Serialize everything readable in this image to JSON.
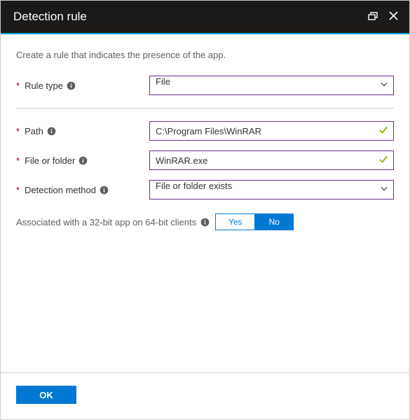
{
  "titlebar": {
    "title": "Detection rule",
    "restore_icon": "restore-icon",
    "close_icon": "close-icon"
  },
  "description": "Create a rule that indicates the presence of the app.",
  "form": {
    "rule_type": {
      "label": "Rule type",
      "value": "File",
      "required": true
    },
    "path": {
      "label": "Path",
      "value": "C:\\Program Files\\WinRAR",
      "required": true,
      "valid": true
    },
    "file_or_folder": {
      "label": "File or folder",
      "value": "WinRAR.exe",
      "required": true,
      "valid": true
    },
    "detection_method": {
      "label": "Detection method",
      "value": "File or folder exists",
      "required": true
    }
  },
  "associated": {
    "label": "Associated with a 32-bit app on 64-bit clients",
    "yes": "Yes",
    "no": "No",
    "selected": "No"
  },
  "footer": {
    "ok": "OK"
  },
  "colors": {
    "accent": "#0078d4",
    "field_border": "#6b2d90",
    "required": "#a80000",
    "valid": "#107c10"
  }
}
